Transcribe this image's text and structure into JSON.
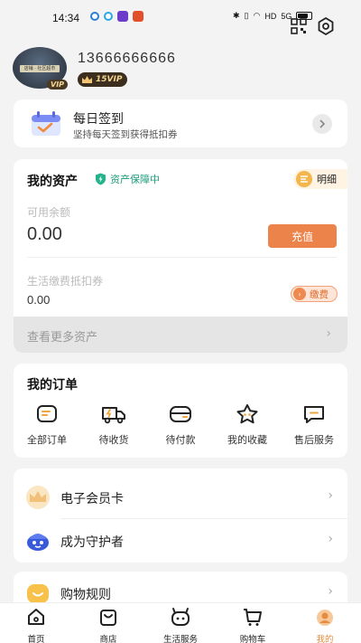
{
  "status_bar": {
    "time": "14:34",
    "network": "HD",
    "signal": "5G"
  },
  "profile": {
    "phone": "13666666666",
    "vip_tag": "VIP",
    "level": "15VIP",
    "avatar_sign_text": "店铺 · 社区超市"
  },
  "checkin": {
    "title": "每日签到",
    "subtitle": "坚持每天签到获得抵扣券"
  },
  "assets": {
    "title": "我的资产",
    "protect_label": "资产保障中",
    "detail_label": "明细",
    "balance_label": "可用余额",
    "balance_value": "0.00",
    "recharge_label": "充值",
    "coupon_label": "生活缴费抵扣券",
    "coupon_value": "0.00",
    "pay_label": "缴费",
    "more_label": "查看更多资产"
  },
  "orders": {
    "title": "我的订单",
    "items": [
      {
        "label": "全部订单",
        "icon": "all-orders-icon"
      },
      {
        "label": "待收货",
        "icon": "truck-icon"
      },
      {
        "label": "待付款",
        "icon": "wallet-card-icon"
      },
      {
        "label": "我的收藏",
        "icon": "star-icon"
      },
      {
        "label": "售后服务",
        "icon": "chat-service-icon"
      }
    ]
  },
  "member_rows": [
    {
      "label": "电子会员卡",
      "icon": "crown-card-icon"
    },
    {
      "label": "成为守护者",
      "icon": "guardian-mascot-icon"
    }
  ],
  "rules": {
    "label": "购物规则",
    "icon": "rules-icon"
  },
  "tabbar": {
    "items": [
      {
        "label": "首页",
        "icon": "home-icon",
        "active": false
      },
      {
        "label": "商店",
        "icon": "shopping-bag-icon",
        "active": false
      },
      {
        "label": "生活服务",
        "icon": "life-service-icon",
        "active": false
      },
      {
        "label": "购物车",
        "icon": "cart-icon",
        "active": false
      },
      {
        "label": "我的",
        "icon": "profile-icon",
        "active": true
      }
    ]
  },
  "colors": {
    "accent": "#ec834a",
    "protect_green": "#1e9d7a",
    "vip_gold": "#f4d38e",
    "active_tab": "#e58c3e"
  }
}
